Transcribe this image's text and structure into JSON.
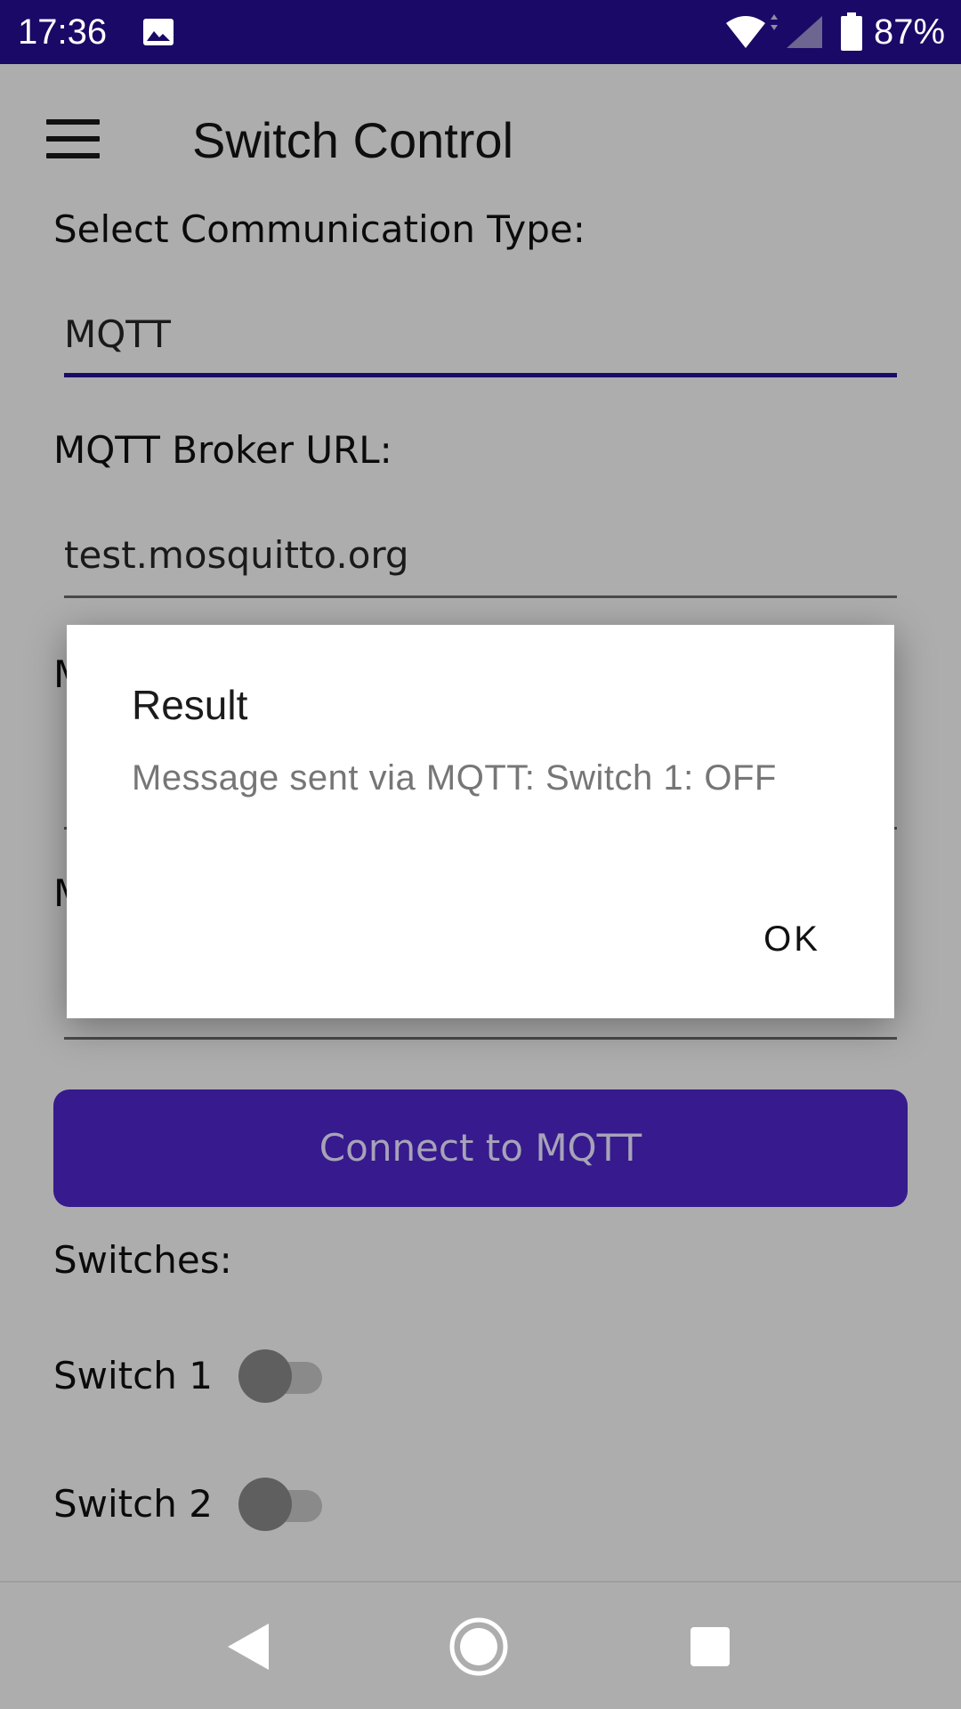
{
  "status_bar": {
    "time": "17:36",
    "battery_percent": "87%",
    "icons": [
      "gallery-icon",
      "wifi-icon",
      "signal-icon",
      "battery-icon"
    ],
    "background": "#1a0966"
  },
  "app_bar": {
    "title": "Switch Control",
    "menu_icon": "hamburger-menu-icon"
  },
  "form": {
    "comm_type_label": "Select Communication Type:",
    "comm_type_value": "MQTT",
    "broker_url_label": "MQTT Broker URL:",
    "broker_url_value": "test.mosquitto.org",
    "hidden_label_1_initial": "M",
    "hidden_label_2_initial": "M",
    "connect_button_label": "Connect to MQTT"
  },
  "switches": {
    "section_label": "Switches:",
    "items": [
      {
        "label": "Switch 1",
        "on": false
      },
      {
        "label": "Switch 2",
        "on": false
      }
    ]
  },
  "dialog": {
    "title": "Result",
    "message": "Message sent via MQTT: Switch 1: OFF",
    "ok_label": "OK"
  },
  "colors": {
    "accent": "#371a8d",
    "scrim_background": "#adadad",
    "focused_underline": "#1a0b66"
  },
  "nav_bar": {
    "icons": [
      "back-icon",
      "home-icon",
      "recents-icon"
    ]
  }
}
